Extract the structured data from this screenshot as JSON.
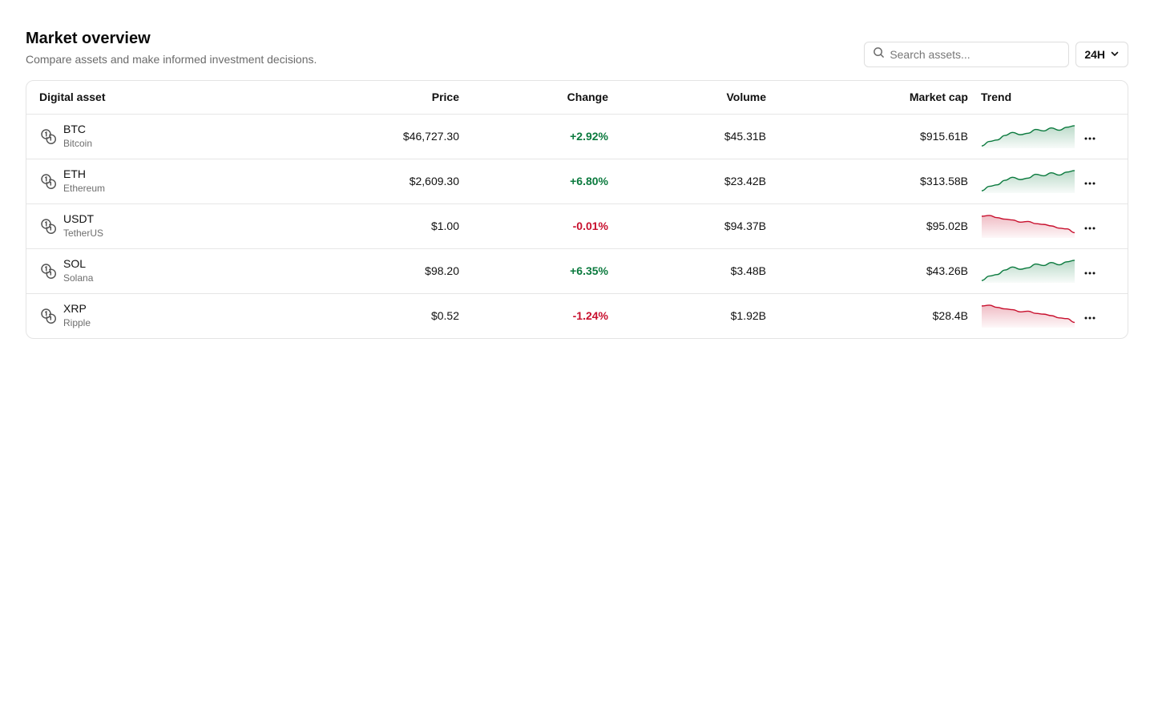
{
  "header": {
    "title": "Market overview",
    "subtitle": "Compare assets and make informed investment decisions."
  },
  "search": {
    "placeholder": "Search assets...",
    "icon": "search-icon"
  },
  "range": {
    "label": "24H",
    "icon": "chevron-down-icon"
  },
  "table": {
    "columns": [
      "Digital asset",
      "Price",
      "Change",
      "Volume",
      "Market cap",
      "Trend"
    ],
    "rows": [
      {
        "symbol": "BTC",
        "name": "Bitcoin",
        "price": "$46,727.30",
        "change": "+2.92%",
        "direction": "up",
        "volume": "$45.31B",
        "market_cap": "$915.61B",
        "trend": [
          2,
          8,
          10,
          16,
          20,
          17,
          19,
          24,
          22,
          26,
          23,
          27,
          29
        ]
      },
      {
        "symbol": "ETH",
        "name": "Ethereum",
        "price": "$2,609.30",
        "change": "+6.80%",
        "direction": "up",
        "volume": "$23.42B",
        "market_cap": "$313.58B",
        "trend": [
          2,
          8,
          10,
          16,
          20,
          17,
          19,
          24,
          22,
          26,
          23,
          27,
          29
        ]
      },
      {
        "symbol": "USDT",
        "name": "TetherUS",
        "price": "$1.00",
        "change": "-0.01%",
        "direction": "down",
        "volume": "$94.37B",
        "market_cap": "$95.02B",
        "trend": [
          28,
          29,
          26,
          24,
          23,
          20,
          21,
          18,
          17,
          15,
          12,
          11,
          6
        ]
      },
      {
        "symbol": "SOL",
        "name": "Solana",
        "price": "$98.20",
        "change": "+6.35%",
        "direction": "up",
        "volume": "$3.48B",
        "market_cap": "$43.26B",
        "trend": [
          2,
          8,
          10,
          16,
          20,
          17,
          19,
          24,
          22,
          26,
          23,
          27,
          29
        ]
      },
      {
        "symbol": "XRP",
        "name": "Ripple",
        "price": "$0.52",
        "change": "-1.24%",
        "direction": "down",
        "volume": "$1.92B",
        "market_cap": "$28.4B",
        "trend": [
          28,
          29,
          26,
          24,
          23,
          20,
          21,
          18,
          17,
          15,
          12,
          11,
          6
        ]
      }
    ]
  },
  "colors": {
    "up": "#0b7a3e",
    "down": "#c8102e",
    "border": "#e4e4e4",
    "muted": "#6b6b6b"
  },
  "icons": {
    "asset": "coins-icon",
    "more": "more-horizontal-icon"
  }
}
